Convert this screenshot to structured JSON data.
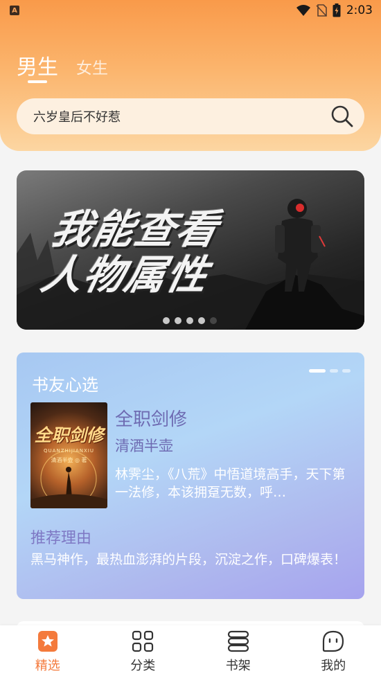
{
  "status_bar": {
    "time": "2:03",
    "app_badge": "A"
  },
  "header": {
    "tabs": [
      {
        "label": "男生",
        "active": true
      },
      {
        "label": "女生",
        "active": false
      }
    ],
    "search": {
      "text": "六岁皇后不好惹",
      "icon": "search-icon"
    }
  },
  "banner": {
    "title_line1": "我能查看",
    "title_line2": "人物属性",
    "slide_count": 5,
    "active_slide": 4
  },
  "recommendation": {
    "heading": "书友心选",
    "book": {
      "cover_title": "全职剑修",
      "cover_subtitle": "QUANZHIJIANXIU",
      "cover_author": "清酒半壶 ◎ 著",
      "title": "全职剑修",
      "author": "清酒半壶",
      "description": "林霁尘，《八荒》中悟道境高手，天下第一法修，本该拥趸无数，呼…"
    },
    "reason_label": "推荐理由",
    "reason_text": "黑马神作，最热血澎湃的片段，沉淀之作，口碑爆表！",
    "page_count": 3,
    "active_page": 1
  },
  "bottom_nav": [
    {
      "label": "精选",
      "icon": "featured-star-icon",
      "active": true
    },
    {
      "label": "分类",
      "icon": "category-grid-icon",
      "active": false
    },
    {
      "label": "书架",
      "icon": "bookshelf-icon",
      "active": false
    },
    {
      "label": "我的",
      "icon": "profile-face-icon",
      "active": false
    }
  ],
  "colors": {
    "accent": "#f47a3c",
    "header_top": "#f99a4a",
    "card_text": "#6e6bb2"
  }
}
